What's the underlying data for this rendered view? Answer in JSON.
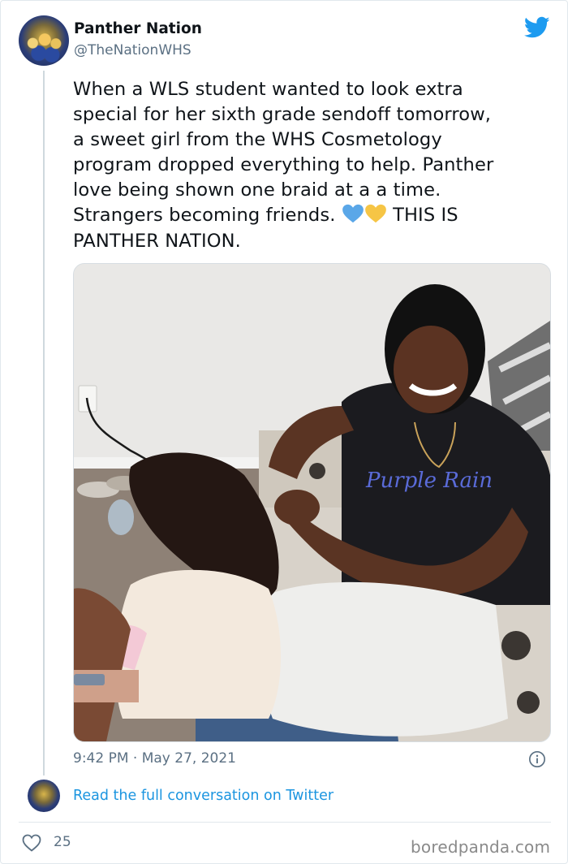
{
  "tweet": {
    "author_name": "Panther Nation",
    "author_handle": "@TheNationWHS",
    "text_before_hearts": "When a WLS student wanted to look extra\nspecial for her sixth grade sendoff tomorrow,\na sweet girl from the WHS Cosmetology\nprogram dropped everything to help. Panther\nlove being shown one braid at a a time.\nStrangers becoming friends. ",
    "text_after_hearts": " THIS IS\nPANTHER NATION.",
    "emoji": [
      "blue-heart",
      "yellow-heart"
    ],
    "timestamp": "9:42 PM · May 27, 2021",
    "read_more": "Read the full conversation on Twitter",
    "like_count": "25"
  },
  "watermark": "boredpanda.com",
  "colors": {
    "link": "#1b95e0",
    "twitter_blue": "#1d9bf0",
    "secondary_text": "#5b7083",
    "blue_heart": "#5aa7e8",
    "yellow_heart": "#f6c545"
  },
  "icons": {
    "bird": "twitter-bird-icon",
    "info": "info-icon",
    "like": "heart-icon"
  }
}
